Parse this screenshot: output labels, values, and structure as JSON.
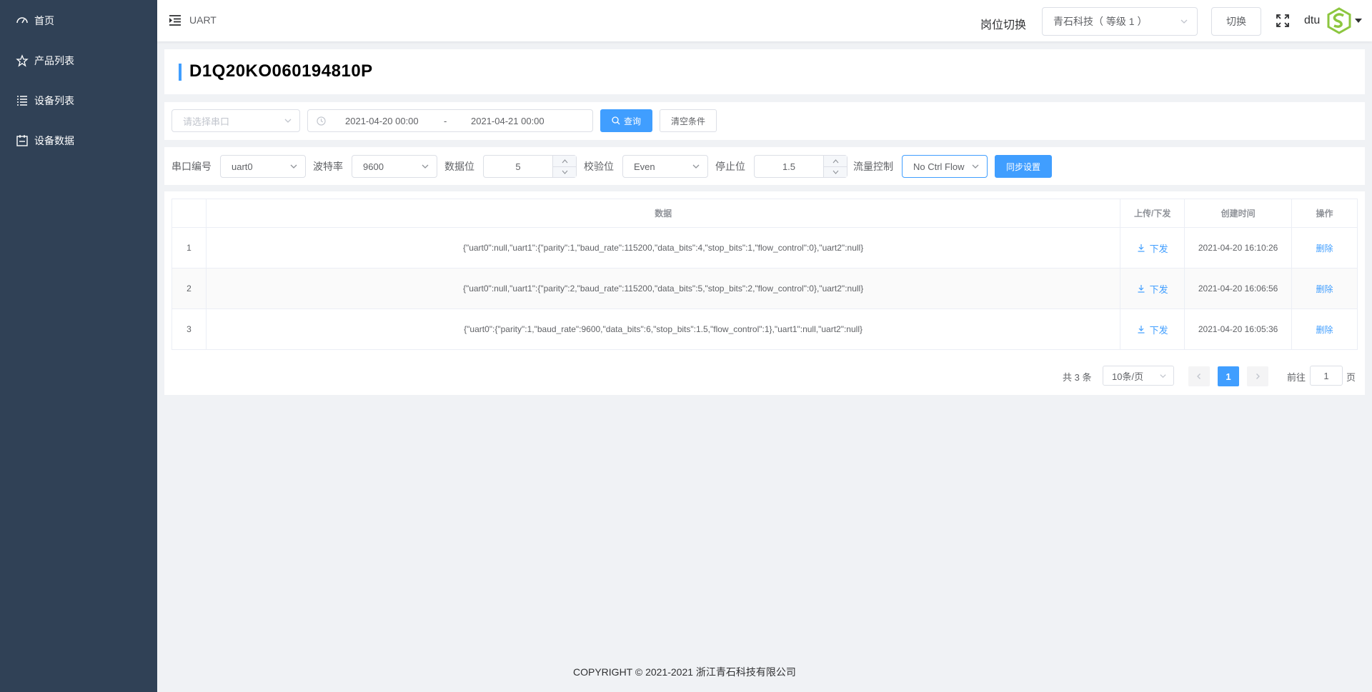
{
  "sidebar": {
    "items": [
      {
        "label": "首页",
        "icon": "dashboard-icon"
      },
      {
        "label": "产品列表",
        "icon": "star-icon"
      },
      {
        "label": "设备列表",
        "icon": "list-icon"
      },
      {
        "label": "设备数据",
        "icon": "calendar-icon"
      }
    ]
  },
  "header": {
    "breadcrumb": "UART",
    "post_label": "岗位切换",
    "post_selected": "青石科技（ 等级 1 ）",
    "switch_label": "切换",
    "user_name": "dtu"
  },
  "device": {
    "title": "D1Q20KO060194810P"
  },
  "filter": {
    "port_placeholder": "请选择串口",
    "start_time": "2021-04-20 00:00",
    "separator": "-",
    "end_time": "2021-04-21 00:00",
    "query_label": "查询",
    "clear_label": "清空条件"
  },
  "uart_settings": {
    "port_label": "串口编号",
    "port_value": "uart0",
    "baud_label": "波特率",
    "baud_value": "9600",
    "data_bits_label": "数据位",
    "data_bits_value": "5",
    "parity_label": "校验位",
    "parity_value": "Even",
    "stop_bits_label": "停止位",
    "stop_bits_value": "1.5",
    "flow_label": "流量控制",
    "flow_value": "No Ctrl Flow",
    "sync_label": "同步设置"
  },
  "table": {
    "columns": [
      "",
      "数据",
      "上传/下发",
      "创建时间",
      "操作"
    ],
    "rows": [
      {
        "index": "1",
        "data": "{\"uart0\":null,\"uart1\":{\"parity\":1,\"baud_rate\":115200,\"data_bits\":4,\"stop_bits\":1,\"flow_control\":0},\"uart2\":null}",
        "direction": "下发",
        "created": "2021-04-20 16:10:26",
        "action": "删除"
      },
      {
        "index": "2",
        "data": "{\"uart0\":null,\"uart1\":{\"parity\":2,\"baud_rate\":115200,\"data_bits\":5,\"stop_bits\":2,\"flow_control\":0},\"uart2\":null}",
        "direction": "下发",
        "created": "2021-04-20 16:06:56",
        "action": "删除"
      },
      {
        "index": "3",
        "data": "{\"uart0\":{\"parity\":1,\"baud_rate\":9600,\"data_bits\":6,\"stop_bits\":1.5,\"flow_control\":1},\"uart1\":null,\"uart2\":null}",
        "direction": "下发",
        "created": "2021-04-20 16:05:36",
        "action": "删除"
      }
    ]
  },
  "pagination": {
    "total": "共 3 条",
    "page_size": "10条/页",
    "current_page": "1",
    "goto_label": "前往",
    "goto_value": "1",
    "page_suffix": "页"
  },
  "footer": {
    "copyright": "COPYRIGHT © 2021-2021 浙江青石科技有限公司"
  },
  "colors": {
    "sidebar_bg": "#304156",
    "primary": "#409eff",
    "page_bg": "#f0f2f5",
    "logo_green": "#8cc63f"
  }
}
